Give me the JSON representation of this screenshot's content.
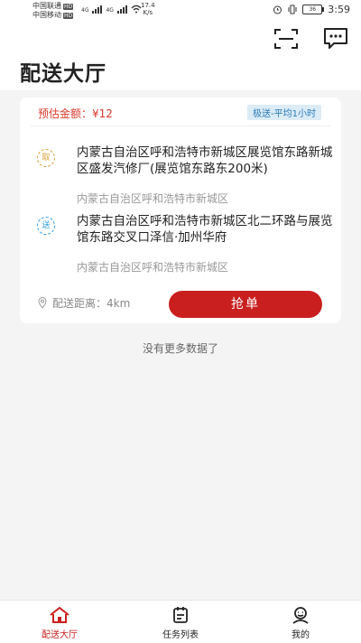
{
  "status_bar": {
    "carrier1": "中国联通",
    "carrier2": "中国移动",
    "hd": "HD",
    "net1": "4G",
    "net2": "4G",
    "speed_value": "17.4",
    "speed_unit": "K/s",
    "battery": "36",
    "time": "3:59"
  },
  "header": {
    "title": "配送大厅"
  },
  "order": {
    "price_label": "预估金额：¥12",
    "tag": "极送-平均1小时",
    "pickup": {
      "icon_text": "取",
      "address": "内蒙古自治区呼和浩特市新城区展览馆东路新城区盛发汽修厂(展览馆东路东200米)",
      "region": "内蒙古自治区呼和浩特市新城区"
    },
    "dropoff": {
      "icon_text": "送",
      "address": "内蒙古自治区呼和浩特市新城区北二环路与展览馆东路交叉口泽信·加州华府",
      "region": "内蒙古自治区呼和浩特市新城区"
    },
    "distance": "配送距离：4km",
    "grab_button": "抢单"
  },
  "list_end_text": "没有更多数据了",
  "tabbar": {
    "items": [
      {
        "label": "配送大厅",
        "icon": "home-icon",
        "active": true
      },
      {
        "label": "任务列表",
        "icon": "task-list-icon",
        "active": false
      },
      {
        "label": "我的",
        "icon": "profile-icon",
        "active": false
      }
    ]
  },
  "colors": {
    "accent": "#c91f1f",
    "tag_bg": "#dcecf7",
    "tag_text": "#2a7ab8",
    "price": "#d93a2a"
  }
}
